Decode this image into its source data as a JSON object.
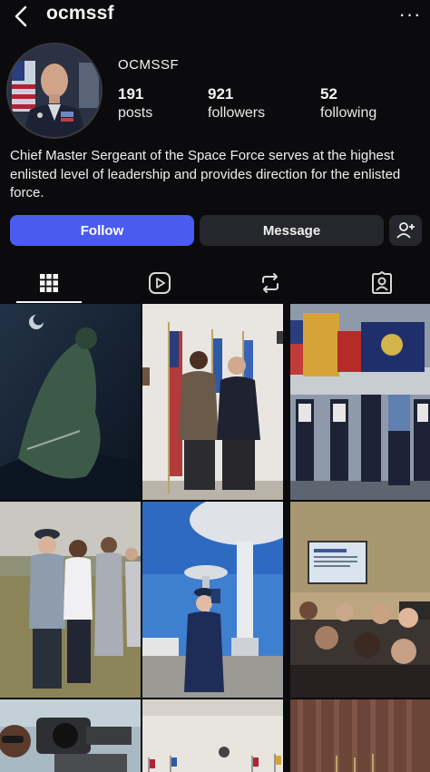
{
  "header": {
    "username": "ocmssf",
    "back_icon": "chevron-left-icon",
    "more_icon": "more-horizontal-icon",
    "more_label": "···"
  },
  "profile": {
    "display_name": "OCMSSF",
    "avatar_icon": "profile-avatar",
    "stats": {
      "posts": {
        "count": "191",
        "label": "posts"
      },
      "followers": {
        "count": "921",
        "label": "followers"
      },
      "following": {
        "count": "52",
        "label": "following"
      }
    },
    "bio": "Chief Master Sergeant of the Space Force serves at the highest enlisted level of leadership and provides direction for the enlisted force."
  },
  "actions": {
    "follow_label": "Follow",
    "message_label": "Message",
    "add_user_icon": "add-user-icon"
  },
  "tabs": [
    {
      "icon": "grid-icon",
      "active": true
    },
    {
      "icon": "reels-icon",
      "active": false
    },
    {
      "icon": "reposts-icon",
      "active": false
    },
    {
      "icon": "tagged-icon",
      "active": false
    }
  ],
  "colors": {
    "background": "#0b0b0d",
    "follow_button": "#4a5cf0",
    "secondary_button": "#26272c"
  }
}
